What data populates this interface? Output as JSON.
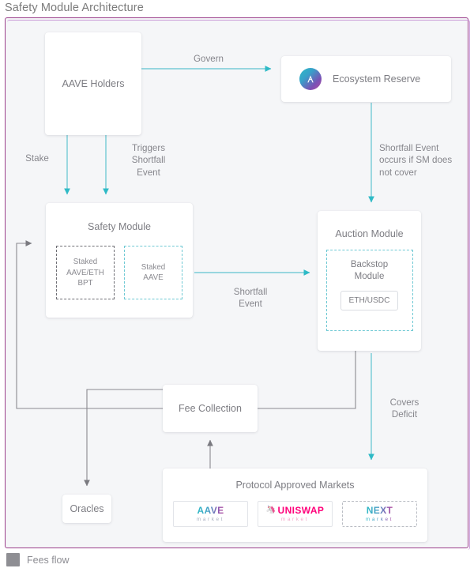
{
  "page": {
    "title": "Safety Module Architecture"
  },
  "colors": {
    "frame_border": "#9b3f8c",
    "frame_border_secondary": "#c48fd4",
    "canvas_bg": "#f5f6f8",
    "teal_flow": "#2ebac6",
    "fees_flow": "#8e8e93",
    "text": "#7d7d83",
    "uniswap_pink": "#ff007a"
  },
  "nodes": {
    "aave_holders": {
      "label": "AAVE Holders"
    },
    "ecosystem_reserve": {
      "label": "Ecosystem Reserve",
      "icon": "aave-logo-icon"
    },
    "safety_module": {
      "title": "Safety Module",
      "sub_boxes": [
        {
          "label": "Staked\nAAVE/ETH\nBPT",
          "style": "gray-dashed"
        },
        {
          "label": "Staked\nAAVE",
          "style": "teal-dashed"
        }
      ]
    },
    "auction_module": {
      "title": "Auction Module",
      "backstop": {
        "title": "Backstop\nModule",
        "pair": "ETH/USDC"
      }
    },
    "fee_collection": {
      "label": "Fee Collection"
    },
    "oracles": {
      "label": "Oracles"
    },
    "markets": {
      "title": "Protocol Approved Markets",
      "items": [
        {
          "brand": "AAVE",
          "sub": "market",
          "style": "gradient",
          "icon": "aave-wordmark-icon"
        },
        {
          "brand": "UNISWAP",
          "sub": "market",
          "style": "pink",
          "icon": "unicorn-icon"
        },
        {
          "brand": "NEXT",
          "sub": "market",
          "style": "gradient-dashed",
          "icon": "none"
        }
      ]
    }
  },
  "edges": [
    {
      "label": "Govern",
      "from": "aave_holders",
      "to": "ecosystem_reserve",
      "flow": "teal"
    },
    {
      "label": "Stake",
      "from": "aave_holders",
      "to": "safety_module",
      "flow": "teal"
    },
    {
      "label": "Triggers\nShortfall\nEvent",
      "from": "aave_holders",
      "to": "safety_module",
      "flow": "teal"
    },
    {
      "label": "Shortfall Event\noccurs if SM does\nnot cover",
      "from": "ecosystem_reserve",
      "to": "auction_module",
      "flow": "teal"
    },
    {
      "label": "Shortfall\nEvent",
      "from": "safety_module",
      "to": "auction_module",
      "flow": "teal"
    },
    {
      "label": "Covers\nDeficit",
      "from": "auction_module",
      "to": "markets",
      "flow": "teal"
    }
  ],
  "edge_labels": {
    "govern": "Govern",
    "stake": "Stake",
    "triggers_shortfall": "Triggers\nShortfall\nEvent",
    "shortfall_occurs": "Shortfall Event\noccurs if SM does\nnot cover",
    "shortfall_event": "Shortfall\nEvent",
    "covers_deficit": "Covers\nDeficit"
  },
  "legend": {
    "label": "Fees flow",
    "swatch_color": "#8e8e93"
  }
}
